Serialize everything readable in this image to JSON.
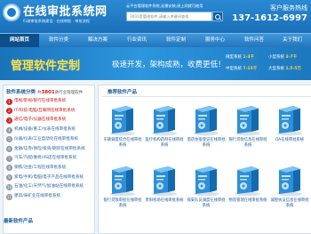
{
  "header": {
    "logo_title": "在线审批系统网",
    "logo_subtitle": "行政审批系统建设 · 在线审批 · 审批流程",
    "tagline": "云平台管理软件系统,无需安装,接上网就可使用",
    "search_placeholder": "3001套管理软件,请输入关键词查找",
    "hotline_label": "客户服务热线",
    "hotline_number": "137-1612-6997"
  },
  "nav": {
    "items": [
      "网站首页",
      "软件分类",
      "解决方案",
      "行业资讯",
      "软件定制",
      "服务中心",
      "软件问答",
      "关于我们"
    ],
    "active_index": 0
  },
  "banner": {
    "title": "管理软件定制",
    "slogan": "极速开发，架构成熟，收费更低！",
    "prices": [
      {
        "label": "微型系统",
        "value": "1-3",
        "unit": "千"
      },
      {
        "label": "小型系统",
        "value": "3-7",
        "unit": "千"
      },
      {
        "label": "中型系统",
        "value": "7-15",
        "unit": "千"
      },
      {
        "label": "大型系统",
        "value": "1.5-5",
        "unit": "万"
      }
    ]
  },
  "left": {
    "heading": "软件系统分类",
    "count_prefix": "共",
    "count": "3801",
    "count_suffix": "款行业管理软件",
    "categories": [
      {
        "num": "1",
        "label": "电视/影视/银行在线审批系统",
        "hot": true
      },
      {
        "num": "2",
        "label": "IT/科技/电脑/互联网在线审批系统",
        "hot": true
      },
      {
        "num": "3",
        "label": "通信/电子/仪器在线审批系统",
        "hot": true
      },
      {
        "num": "4",
        "label": "机械/设备/重工/仪表在线审批系统",
        "hot": false
      },
      {
        "num": "5",
        "label": "仪器/仪表/工业自动化在线审批系统",
        "hot": false
      },
      {
        "num": "6",
        "label": "金融/证券/保险/投资/期货在线审批系统",
        "hot": false
      },
      {
        "num": "7",
        "label": "汽车/汽配/维修/4S店在线审批系统",
        "hot": false
      },
      {
        "num": "8",
        "label": "钢铁/冶金/工程在线审批系统",
        "hot": false
      },
      {
        "num": "9",
        "label": "家电/手机/电脑/电子产品在线审批系统",
        "hot": false
      },
      {
        "num": "10",
        "label": "石油/化工/天然气/加油站在线审批系统",
        "hot": false
      },
      {
        "num": "11",
        "label": "建筑/采矿业在线审批系统",
        "hot": false
      }
    ]
  },
  "right": {
    "heading": "推荐软件产品",
    "products": [
      "车辆调度综合在线审批系统",
      "医疗机构药剂在线审批系统",
      "酒店住宿登记在线审批系统",
      "银行贷款信息在线审批系统",
      "OA在线审批系统",
      "银行贷款审批在线审批系统",
      "贵阳机场在线审批系统",
      "保安队员调度在线审批系统",
      "物资管理在线审批系统",
      "城管执法信息在线审批系统"
    ]
  },
  "bottom": {
    "heading": "最新软件产品"
  },
  "colors": {
    "brand_blue": "#1a6fb8",
    "accent_yellow": "#ffe24a",
    "hot_red": "#d02424"
  }
}
